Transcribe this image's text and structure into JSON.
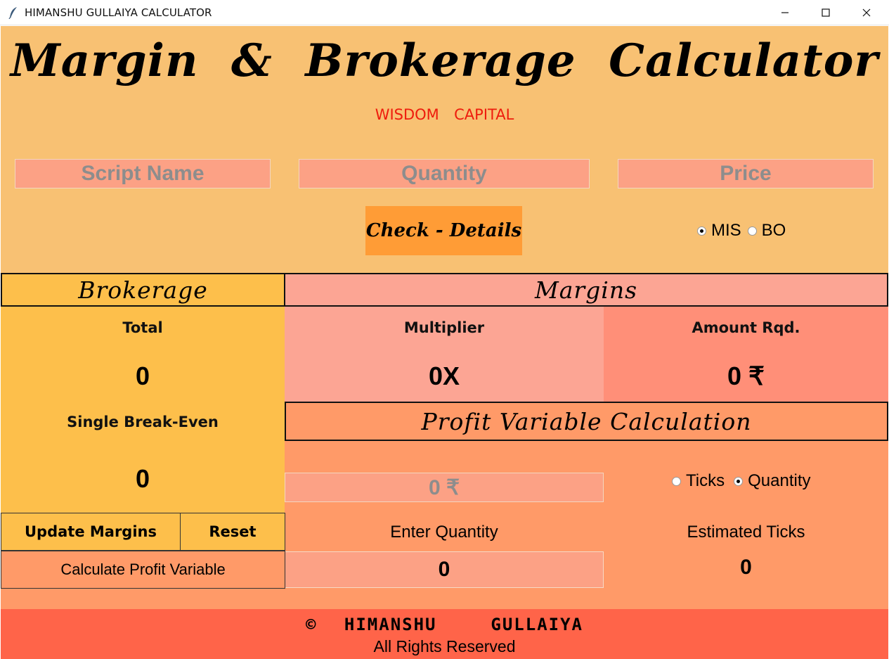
{
  "window": {
    "title": "HIMANSHU GULLAIYA CALCULATOR",
    "icon": "feather-icon",
    "controls": [
      "minimize-icon",
      "maximize-icon",
      "close-icon"
    ]
  },
  "header": {
    "title": "Margin  &  Brokerage  Calculator",
    "subtitle": "WISDOM  CAPITAL"
  },
  "inputs": {
    "script_name": "Script Name",
    "quantity": "Quantity",
    "price": "Price"
  },
  "check_button": "Check - Details",
  "order_type": {
    "options": [
      "MIS",
      "BO"
    ],
    "selected": "MIS"
  },
  "brokerage": {
    "title": "Brokerage",
    "total_label": "Total",
    "total_value": "0",
    "breakeven_label": "Single Break-Even",
    "breakeven_value": "0"
  },
  "margins": {
    "title": "Margins",
    "multiplier_label": "Multiplier",
    "multiplier_value": "0X",
    "amount_label": "Amount Rqd.",
    "amount_value": "0 ₹"
  },
  "profit_variable": {
    "title": "Profit Variable Calculation",
    "amount_entry": "0 ₹",
    "mode_options": [
      "Ticks",
      "Quantity"
    ],
    "mode_selected": "Quantity",
    "enter_label": "Enter Quantity",
    "enter_value": "0",
    "estimate_label": "Estimated Ticks",
    "estimate_value": "0"
  },
  "buttons": {
    "update_margins": "Update Margins",
    "reset": "Reset",
    "calculate": "Calculate Profit Variable"
  },
  "footer": {
    "copyright": "© HIMANSHU  GULLAIYA",
    "rights": "All Rights Reserved"
  },
  "colors": {
    "background": "#f8c173",
    "brokerage_panel": "#fdbf4b",
    "margins_panel": "#fca594",
    "amount_panel": "#ff8f78",
    "profit_panel": "#ff9a68",
    "entry": "#fca185",
    "check_button": "#ff9c36",
    "footer": "#ff6449",
    "subtitle": "#ee1c0d"
  }
}
